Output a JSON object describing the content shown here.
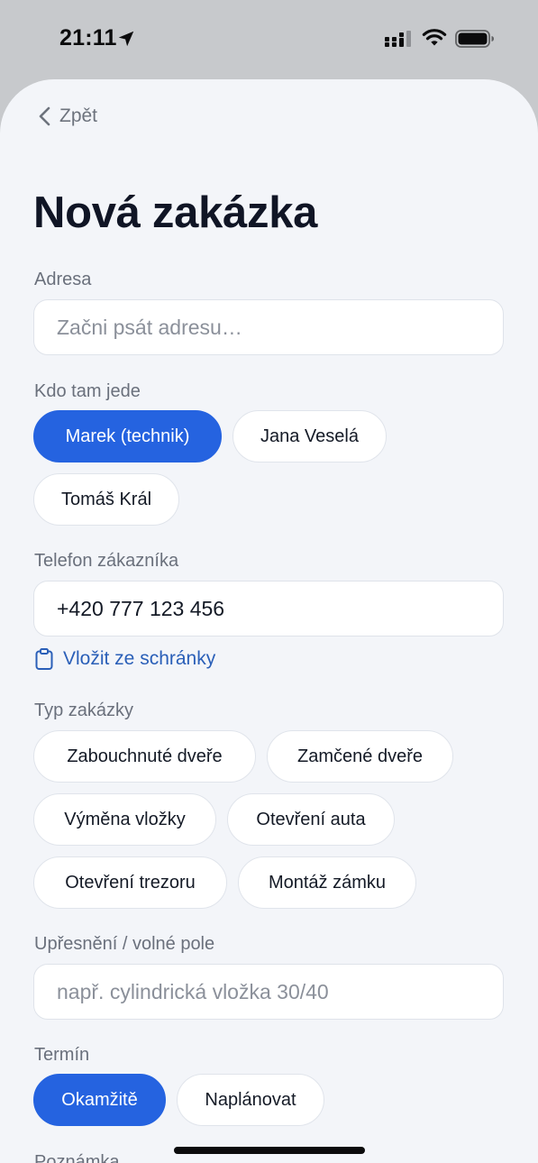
{
  "status_bar": {
    "time": "21:11",
    "icons": [
      "location-arrow-icon",
      "cellular-signal-icon",
      "wifi-icon",
      "battery-icon"
    ]
  },
  "nav": {
    "back_label": "Zpět"
  },
  "page": {
    "title": "Nová zakázka"
  },
  "address": {
    "label": "Adresa",
    "placeholder": "Začni psát adresu…",
    "value": ""
  },
  "assignee": {
    "label": "Kdo tam jede",
    "options": [
      "Marek (technik)",
      "Jana Veselá",
      "Tomáš Král"
    ],
    "selected": "Marek (technik)"
  },
  "phone": {
    "label": "Telefon zákazníka",
    "value": "+420 777 123 456",
    "paste_label": "Vložit ze schránky"
  },
  "job_type": {
    "label": "Typ zakázky",
    "options": [
      "Zabouchnuté dveře",
      "Zamčené dveře",
      "Výměna vložky",
      "Otevření auta",
      "Otevření trezoru",
      "Montáž zámku"
    ],
    "selected": null
  },
  "details": {
    "label": "Upřesnění / volné pole",
    "placeholder": "např. cylindrická vložka 30/40",
    "value": ""
  },
  "timing": {
    "label": "Termín",
    "options": [
      "Okamžitě",
      "Naplánovat"
    ],
    "selected": "Okamžitě"
  },
  "note": {
    "label": "Poznámka"
  },
  "colors": {
    "accent": "#2563e0",
    "sheet_background": "#f3f5f9",
    "status_background": "#c7c9cc",
    "link": "#2a5fb8",
    "label_text": "#6a707c",
    "title_text": "#101525"
  }
}
